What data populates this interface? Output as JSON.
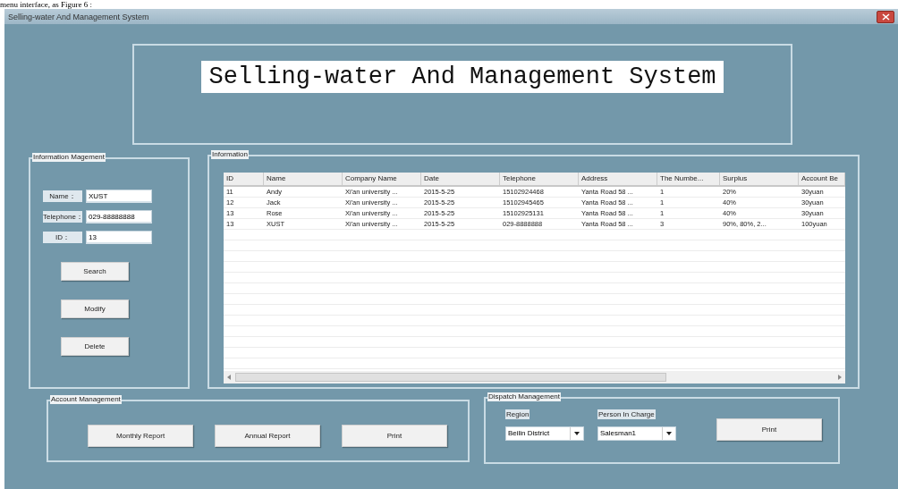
{
  "caption": "menu interface, as Figure 6 :",
  "window": {
    "title": "Selling-water And Management System"
  },
  "banner": {
    "title": "Selling-water And Management System"
  },
  "info_management": {
    "legend": "Information Magement",
    "fields": [
      {
        "label": "Name：",
        "value": "XUST"
      },
      {
        "label": "Telephone：",
        "value": "029-88888888"
      },
      {
        "label": "ID：",
        "value": "13"
      }
    ],
    "buttons": [
      "Search",
      "Modify",
      "Delete"
    ]
  },
  "information": {
    "legend": "Information",
    "table": {
      "columns": [
        "ID",
        "Name",
        "Company Name",
        "Date",
        "Telephone",
        "Address",
        "The Numbe...",
        "Surplus",
        "Account Be"
      ],
      "rows": [
        [
          "11",
          "Andy",
          "Xi'an university ...",
          "2015-5-25",
          "15102924468",
          "Yanta Road 58 ...",
          "1",
          "20%",
          "30yuan"
        ],
        [
          "12",
          "Jack",
          "Xi'an university ...",
          "2015-5-25",
          "15102945465",
          "Yanta Road 58 ...",
          "1",
          "40%",
          "30yuan"
        ],
        [
          "13",
          "Rose",
          "Xi'an university ...",
          "2015-5-25",
          "15102925131",
          "Yanta Road 58 ...",
          "1",
          "40%",
          "30yuan"
        ],
        [
          "13",
          "XUST",
          "Xi'an university ...",
          "2015-5-25",
          "029-8888888",
          "Yanta Road 58 ...",
          "3",
          "90%, 80%, 2...",
          "100yuan"
        ]
      ]
    }
  },
  "account_management": {
    "legend": "Account Management",
    "buttons": [
      "Monthly Report",
      "Annual Report",
      "Print"
    ]
  },
  "dispatch_management": {
    "legend": "Dispatch Management",
    "selects": [
      {
        "label": "Region",
        "value": "Beilin District"
      },
      {
        "label": "Person In Charge",
        "value": "Salesman1"
      }
    ],
    "button": "Print"
  }
}
